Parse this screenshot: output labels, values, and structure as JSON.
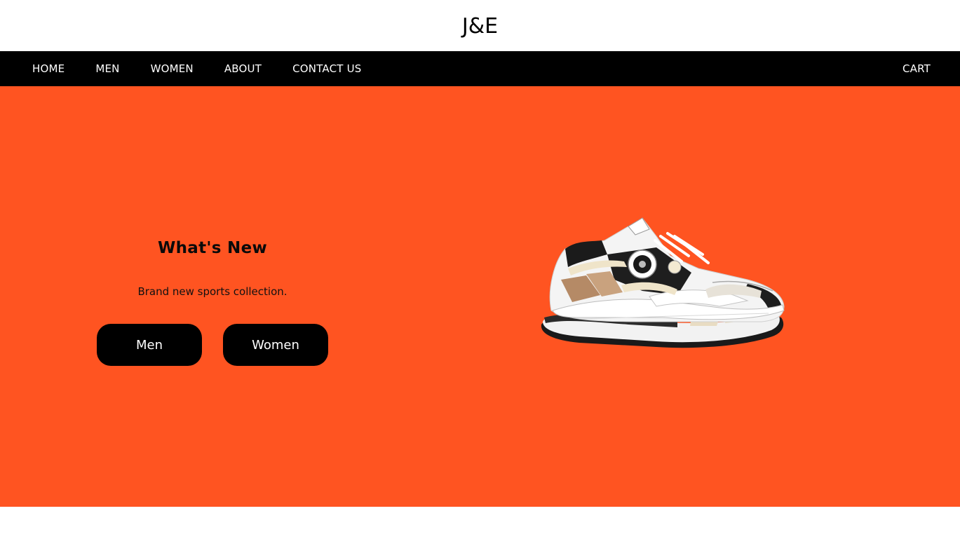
{
  "header": {
    "logo": "J&E"
  },
  "nav": {
    "items": [
      {
        "label": "HOME"
      },
      {
        "label": "MEN"
      },
      {
        "label": "WOMEN"
      },
      {
        "label": "ABOUT"
      },
      {
        "label": "CONTACT US"
      }
    ],
    "cart_label": "CART"
  },
  "hero": {
    "title": "What's New",
    "subtitle": "Brand new sports collection.",
    "buttons": [
      {
        "label": "Men"
      },
      {
        "label": "Women"
      }
    ],
    "background_color": "#ff5421",
    "image_icon": "sneaker-image"
  }
}
